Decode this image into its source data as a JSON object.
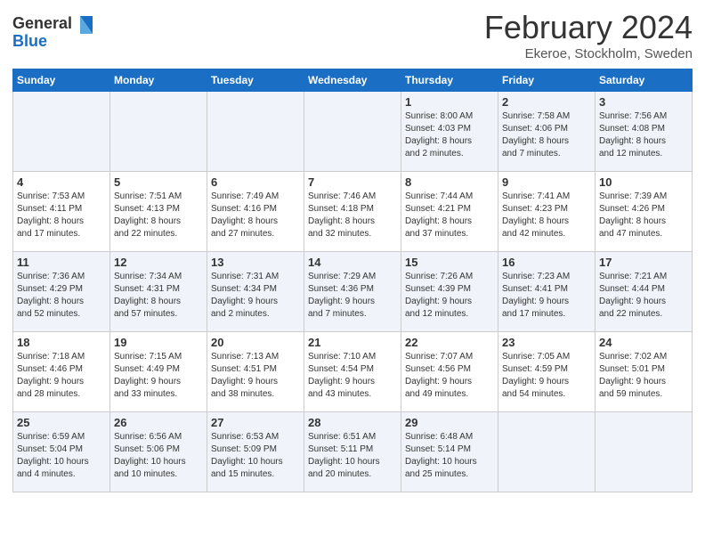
{
  "header": {
    "logo_general": "General",
    "logo_blue": "Blue",
    "month_title": "February 2024",
    "location": "Ekeroe, Stockholm, Sweden"
  },
  "days_of_week": [
    "Sunday",
    "Monday",
    "Tuesday",
    "Wednesday",
    "Thursday",
    "Friday",
    "Saturday"
  ],
  "weeks": [
    [
      {
        "day": "",
        "info": ""
      },
      {
        "day": "",
        "info": ""
      },
      {
        "day": "",
        "info": ""
      },
      {
        "day": "",
        "info": ""
      },
      {
        "day": "1",
        "info": "Sunrise: 8:00 AM\nSunset: 4:03 PM\nDaylight: 8 hours\nand 2 minutes."
      },
      {
        "day": "2",
        "info": "Sunrise: 7:58 AM\nSunset: 4:06 PM\nDaylight: 8 hours\nand 7 minutes."
      },
      {
        "day": "3",
        "info": "Sunrise: 7:56 AM\nSunset: 4:08 PM\nDaylight: 8 hours\nand 12 minutes."
      }
    ],
    [
      {
        "day": "4",
        "info": "Sunrise: 7:53 AM\nSunset: 4:11 PM\nDaylight: 8 hours\nand 17 minutes."
      },
      {
        "day": "5",
        "info": "Sunrise: 7:51 AM\nSunset: 4:13 PM\nDaylight: 8 hours\nand 22 minutes."
      },
      {
        "day": "6",
        "info": "Sunrise: 7:49 AM\nSunset: 4:16 PM\nDaylight: 8 hours\nand 27 minutes."
      },
      {
        "day": "7",
        "info": "Sunrise: 7:46 AM\nSunset: 4:18 PM\nDaylight: 8 hours\nand 32 minutes."
      },
      {
        "day": "8",
        "info": "Sunrise: 7:44 AM\nSunset: 4:21 PM\nDaylight: 8 hours\nand 37 minutes."
      },
      {
        "day": "9",
        "info": "Sunrise: 7:41 AM\nSunset: 4:23 PM\nDaylight: 8 hours\nand 42 minutes."
      },
      {
        "day": "10",
        "info": "Sunrise: 7:39 AM\nSunset: 4:26 PM\nDaylight: 8 hours\nand 47 minutes."
      }
    ],
    [
      {
        "day": "11",
        "info": "Sunrise: 7:36 AM\nSunset: 4:29 PM\nDaylight: 8 hours\nand 52 minutes."
      },
      {
        "day": "12",
        "info": "Sunrise: 7:34 AM\nSunset: 4:31 PM\nDaylight: 8 hours\nand 57 minutes."
      },
      {
        "day": "13",
        "info": "Sunrise: 7:31 AM\nSunset: 4:34 PM\nDaylight: 9 hours\nand 2 minutes."
      },
      {
        "day": "14",
        "info": "Sunrise: 7:29 AM\nSunset: 4:36 PM\nDaylight: 9 hours\nand 7 minutes."
      },
      {
        "day": "15",
        "info": "Sunrise: 7:26 AM\nSunset: 4:39 PM\nDaylight: 9 hours\nand 12 minutes."
      },
      {
        "day": "16",
        "info": "Sunrise: 7:23 AM\nSunset: 4:41 PM\nDaylight: 9 hours\nand 17 minutes."
      },
      {
        "day": "17",
        "info": "Sunrise: 7:21 AM\nSunset: 4:44 PM\nDaylight: 9 hours\nand 22 minutes."
      }
    ],
    [
      {
        "day": "18",
        "info": "Sunrise: 7:18 AM\nSunset: 4:46 PM\nDaylight: 9 hours\nand 28 minutes."
      },
      {
        "day": "19",
        "info": "Sunrise: 7:15 AM\nSunset: 4:49 PM\nDaylight: 9 hours\nand 33 minutes."
      },
      {
        "day": "20",
        "info": "Sunrise: 7:13 AM\nSunset: 4:51 PM\nDaylight: 9 hours\nand 38 minutes."
      },
      {
        "day": "21",
        "info": "Sunrise: 7:10 AM\nSunset: 4:54 PM\nDaylight: 9 hours\nand 43 minutes."
      },
      {
        "day": "22",
        "info": "Sunrise: 7:07 AM\nSunset: 4:56 PM\nDaylight: 9 hours\nand 49 minutes."
      },
      {
        "day": "23",
        "info": "Sunrise: 7:05 AM\nSunset: 4:59 PM\nDaylight: 9 hours\nand 54 minutes."
      },
      {
        "day": "24",
        "info": "Sunrise: 7:02 AM\nSunset: 5:01 PM\nDaylight: 9 hours\nand 59 minutes."
      }
    ],
    [
      {
        "day": "25",
        "info": "Sunrise: 6:59 AM\nSunset: 5:04 PM\nDaylight: 10 hours\nand 4 minutes."
      },
      {
        "day": "26",
        "info": "Sunrise: 6:56 AM\nSunset: 5:06 PM\nDaylight: 10 hours\nand 10 minutes."
      },
      {
        "day": "27",
        "info": "Sunrise: 6:53 AM\nSunset: 5:09 PM\nDaylight: 10 hours\nand 15 minutes."
      },
      {
        "day": "28",
        "info": "Sunrise: 6:51 AM\nSunset: 5:11 PM\nDaylight: 10 hours\nand 20 minutes."
      },
      {
        "day": "29",
        "info": "Sunrise: 6:48 AM\nSunset: 5:14 PM\nDaylight: 10 hours\nand 25 minutes."
      },
      {
        "day": "",
        "info": ""
      },
      {
        "day": "",
        "info": ""
      }
    ]
  ]
}
